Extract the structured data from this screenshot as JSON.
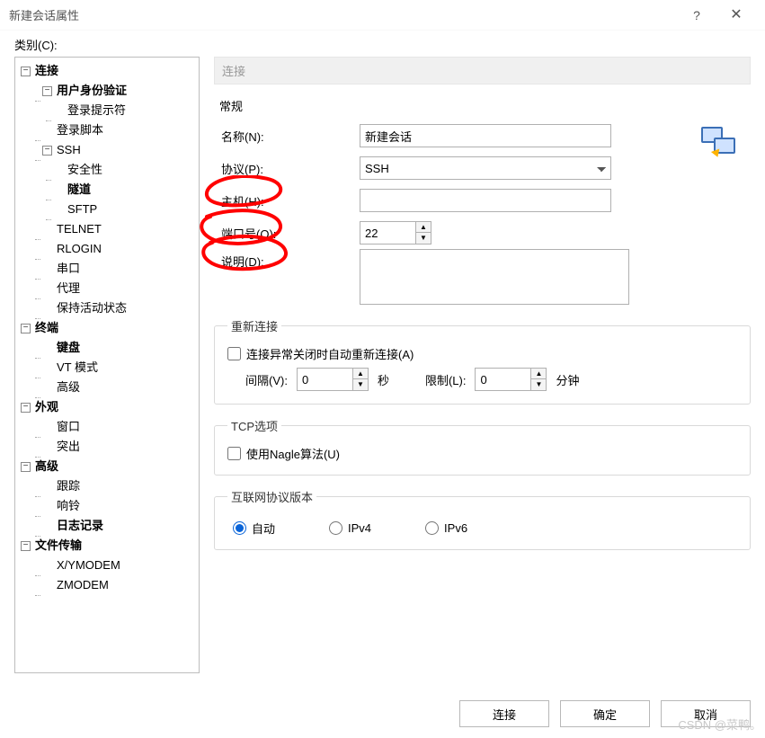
{
  "window": {
    "title": "新建会话属性",
    "help": "?",
    "close": "✕"
  },
  "sidebar": {
    "label": "类别(C):",
    "tree": {
      "connection": "连接",
      "auth": "用户身份验证",
      "login_prompt": "登录提示符",
      "login_script": "登录脚本",
      "ssh": "SSH",
      "security": "安全性",
      "tunnel": "隧道",
      "sftp": "SFTP",
      "telnet": "TELNET",
      "rlogin": "RLOGIN",
      "serial": "串口",
      "proxy": "代理",
      "keepalive": "保持活动状态",
      "terminal": "终端",
      "keyboard": "键盘",
      "vtmode": "VT 模式",
      "advanced_term": "高级",
      "appearance": "外观",
      "window": "窗口",
      "highlight": "突出",
      "advanced": "高级",
      "trace": "跟踪",
      "bell": "响铃",
      "logging": "日志记录",
      "file_transfer": "文件传输",
      "xymodem": "X/YMODEM",
      "zmodem": "ZMODEM"
    }
  },
  "main": {
    "path": "连接",
    "general": {
      "legend": "常规",
      "name_label": "名称(N):",
      "name_value": "新建会话",
      "protocol_label": "协议(P):",
      "protocol_value": "SSH",
      "host_label": "主机(H):",
      "host_value": "",
      "port_label": "端口号(O):",
      "port_value": "22",
      "desc_label": "说明(D):",
      "desc_value": ""
    },
    "reconnect": {
      "legend": "重新连接",
      "checkbox": "连接异常关闭时自动重新连接(A)",
      "interval_label": "间隔(V):",
      "interval_value": "0",
      "interval_unit": "秒",
      "limit_label": "限制(L):",
      "limit_value": "0",
      "limit_unit": "分钟"
    },
    "tcp": {
      "legend": "TCP选项",
      "nagle": "使用Nagle算法(U)"
    },
    "ipver": {
      "legend": "互联网协议版本",
      "auto": "自动",
      "ipv4": "IPv4",
      "ipv6": "IPv6"
    }
  },
  "footer": {
    "connect": "连接",
    "ok": "确定",
    "cancel": "取消"
  },
  "watermark": "CSDN @菜鸭。"
}
